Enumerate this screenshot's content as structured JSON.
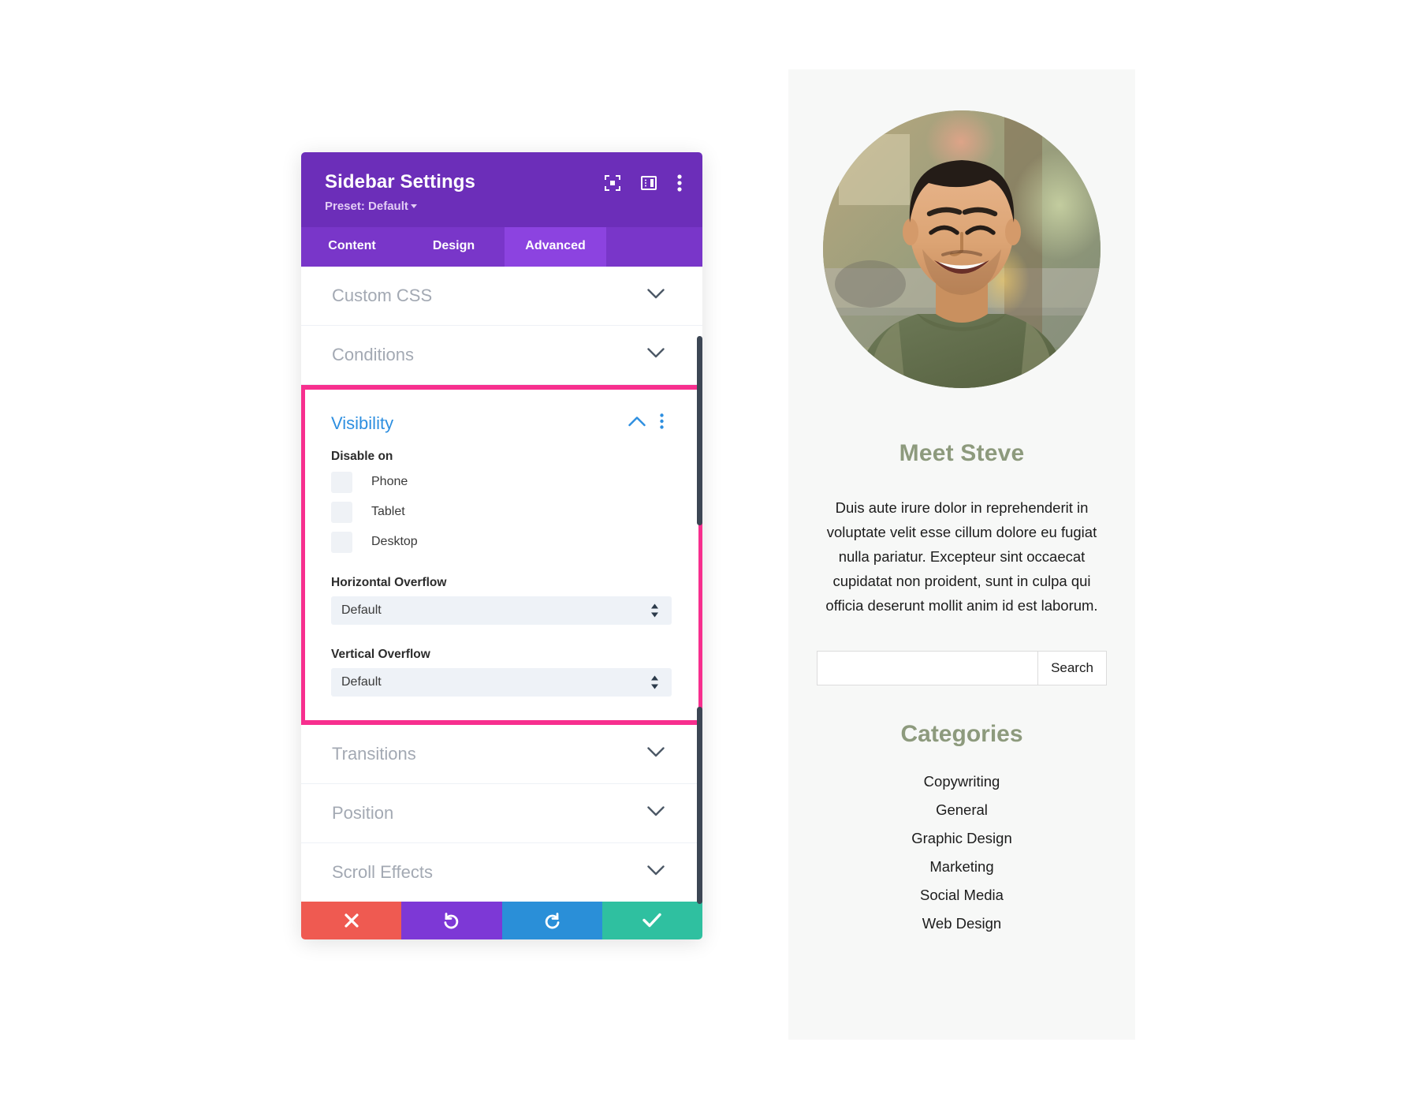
{
  "settings_modal": {
    "title": "Sidebar Settings",
    "preset_label": "Preset: Default",
    "header_icons": [
      {
        "name": "focus-icon"
      },
      {
        "name": "layout-panel-icon"
      },
      {
        "name": "more-vertical-icon"
      }
    ],
    "tabs": [
      {
        "label": "Content",
        "active": false
      },
      {
        "label": "Design",
        "active": false
      },
      {
        "label": "Advanced",
        "active": true
      }
    ],
    "sections_above": [
      {
        "label": "Custom CSS",
        "state": "collapsed"
      },
      {
        "label": "Conditions",
        "state": "collapsed"
      }
    ],
    "visibility": {
      "title": "Visibility",
      "state": "expanded",
      "highlight_color": "#f72f8e",
      "accent_color": "#2e8fe0",
      "disable_on_label": "Disable on",
      "checkboxes": [
        {
          "label": "Phone",
          "checked": false
        },
        {
          "label": "Tablet",
          "checked": false
        },
        {
          "label": "Desktop",
          "checked": false
        }
      ],
      "horizontal_overflow": {
        "label": "Horizontal Overflow",
        "value": "Default"
      },
      "vertical_overflow": {
        "label": "Vertical Overflow",
        "value": "Default"
      }
    },
    "sections_below": [
      {
        "label": "Transitions",
        "state": "collapsed"
      },
      {
        "label": "Position",
        "state": "collapsed"
      },
      {
        "label": "Scroll Effects",
        "state": "collapsed"
      }
    ],
    "footer_buttons": [
      {
        "name": "cancel-button",
        "icon": "close-icon",
        "color": "#ef5a51"
      },
      {
        "name": "undo-button",
        "icon": "undo-icon",
        "color": "#7d38d6"
      },
      {
        "name": "redo-button",
        "icon": "redo-icon",
        "color": "#2a8fd8"
      },
      {
        "name": "save-button",
        "icon": "check-icon",
        "color": "#2fc0a0"
      }
    ]
  },
  "sidebar_preview": {
    "avatar_alt": "portrait-photo",
    "heading": "Meet Steve",
    "bio": "Duis aute irure dolor in reprehenderit in voluptate velit esse cillum dolore eu fugiat nulla pariatur. Excepteur sint occaecat cupidatat non proident, sunt in culpa qui officia deserunt mollit anim id est laborum.",
    "search": {
      "value": "",
      "placeholder": "",
      "button_label": "Search"
    },
    "categories_heading": "Categories",
    "categories": [
      "Copywriting",
      "General",
      "Graphic Design",
      "Marketing",
      "Social Media",
      "Web Design"
    ]
  }
}
